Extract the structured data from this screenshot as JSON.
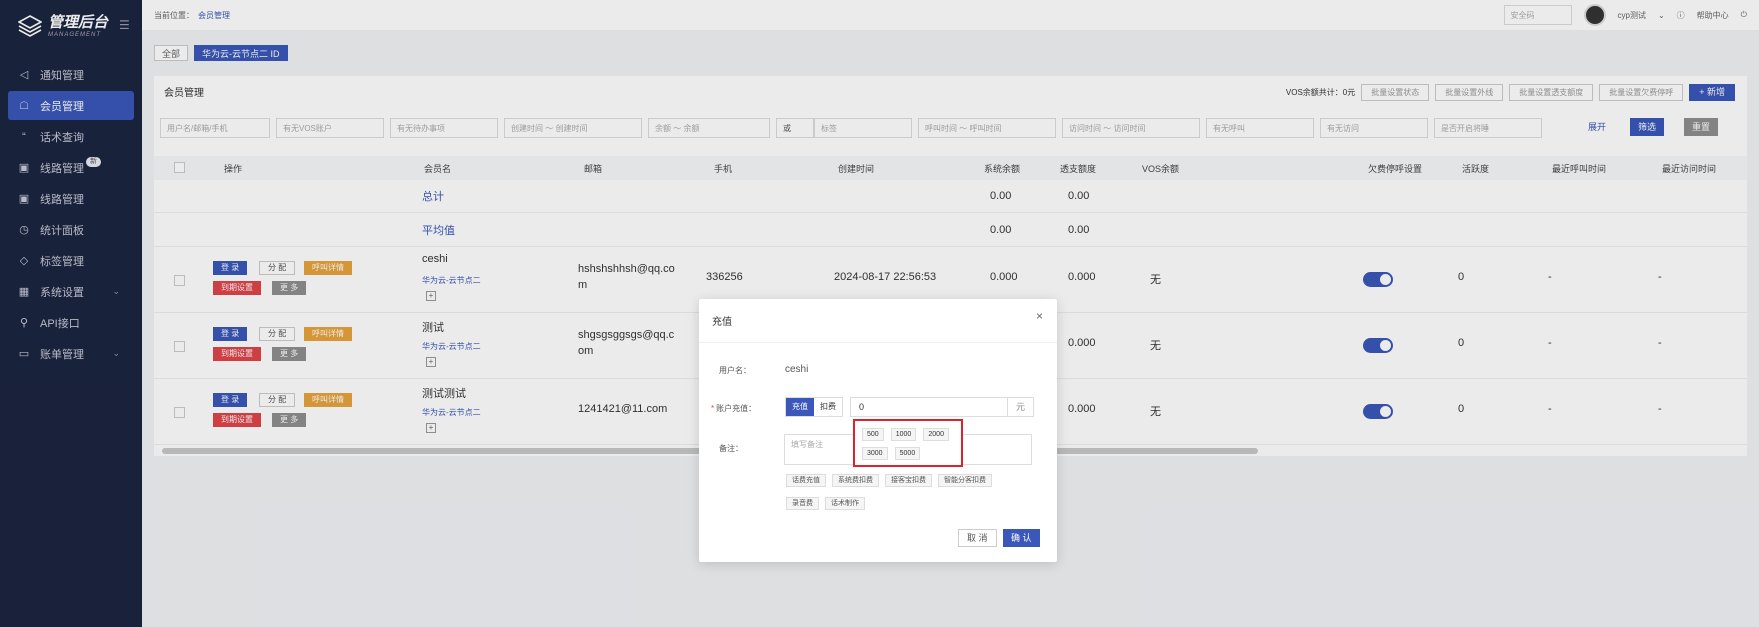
{
  "sidebar": {
    "logo_title": "管理后台",
    "logo_sub": "MANAGEMENT",
    "items": [
      {
        "label": "通知管理",
        "icon": "speaker-icon"
      },
      {
        "label": "会员管理",
        "icon": "users-icon",
        "active": true
      },
      {
        "label": "话术查询",
        "icon": "quote-icon"
      },
      {
        "label": "线路管理",
        "icon": "line-icon",
        "badge": "新"
      },
      {
        "label": "线路管理",
        "icon": "line-icon"
      },
      {
        "label": "统计面板",
        "icon": "clock-icon"
      },
      {
        "label": "标签管理",
        "icon": "tag-icon"
      },
      {
        "label": "系统设置",
        "icon": "grid-icon"
      },
      {
        "label": "API接口",
        "icon": "api-icon"
      },
      {
        "label": "账单管理",
        "icon": "bill-icon"
      }
    ]
  },
  "topbar": {
    "crumb_prefix": "当前位置：",
    "crumb_link": "会员管理",
    "security_placeholder": "安全码",
    "username": "cyp测试",
    "help": "帮助中心"
  },
  "tags": {
    "all": "全部",
    "current": "华为云-云节点二 ID"
  },
  "panel": {
    "title": "会员管理",
    "vos_total": "VOS余额共计：0元",
    "batch_buttons": [
      "批量设置状态",
      "批量设置外线",
      "批量设置透支额度",
      "批量设置欠费停呼"
    ],
    "add_button": "+ 新增"
  },
  "filters": {
    "f1": "用户名/邮箱/手机",
    "f2": "有无VOS账户",
    "f3": "有无待办事项",
    "f4": "创建时间 ～ 创建时间",
    "f5": "余额 ～ 余额",
    "f6": "或",
    "f7": "标签",
    "f8": "呼叫时间 ～ 呼叫时间",
    "f9": "访问时间 ～ 访问时间",
    "f10": "有无呼叫",
    "f11": "有无访问",
    "f12": "是否开启将睡",
    "expand": "展开",
    "filter": "筛选",
    "reset": "重置"
  },
  "table": {
    "headers": [
      "操作",
      "会员名",
      "邮箱",
      "手机",
      "创建时间",
      "系统余额",
      "透支额度",
      "VOS余额",
      "欠费停呼设置",
      "活跃度",
      "最近呼叫时间",
      "最近访问时间"
    ],
    "summary": [
      {
        "label": "总计",
        "balance": "0.00",
        "overdraft": "0.00"
      },
      {
        "label": "平均值",
        "balance": "0.00",
        "overdraft": "0.00"
      }
    ],
    "rows": [
      {
        "name": "ceshi",
        "group": "华为云-云节点二",
        "email": "hshshshhsh@qq.co\nm",
        "phone": "336256",
        "created": "2024-08-17 22:56:53",
        "balance": "0.000",
        "overdraft": "0.000",
        "vos": "无",
        "active": "0",
        "last_call": "-",
        "last_visit": "-"
      },
      {
        "name": "测试",
        "group": "华为云-云节点二",
        "email": "shgsgsggsgs@qq.c\nom",
        "phone": "",
        "created": "",
        "balance": "",
        "overdraft": "0.000",
        "vos": "无",
        "active": "0",
        "last_call": "-",
        "last_visit": "-"
      },
      {
        "name": "测试测试",
        "group": "华为云-云节点二",
        "email": "1241421@11.com",
        "phone": "",
        "created": "",
        "balance": "",
        "overdraft": "0.000",
        "vos": "无",
        "active": "0",
        "last_call": "-",
        "last_visit": "-"
      }
    ],
    "actions": {
      "login": "登 录",
      "assign": "分 配",
      "call_detail": "呼叫详情",
      "expire": "到期设置",
      "more": "更 多"
    }
  },
  "modal": {
    "title": "充值",
    "username_label": "用户名：",
    "username_value": "ceshi",
    "recharge_label": "账户充值：",
    "seg_on": "充值",
    "seg_off": "扣费",
    "amount": "0",
    "unit": "元",
    "remark_label": "备注：",
    "remark_placeholder": "填写备注",
    "amount_options": [
      "500",
      "1000",
      "2000",
      "3000",
      "5000"
    ],
    "quick_tags_row1": [
      "话费充值",
      "系统费扣费",
      "接客宝扣费",
      "智能分客扣费"
    ],
    "quick_tags_row2": [
      "录音费",
      "话术制作"
    ],
    "cancel": "取 消",
    "ok": "确 认"
  }
}
